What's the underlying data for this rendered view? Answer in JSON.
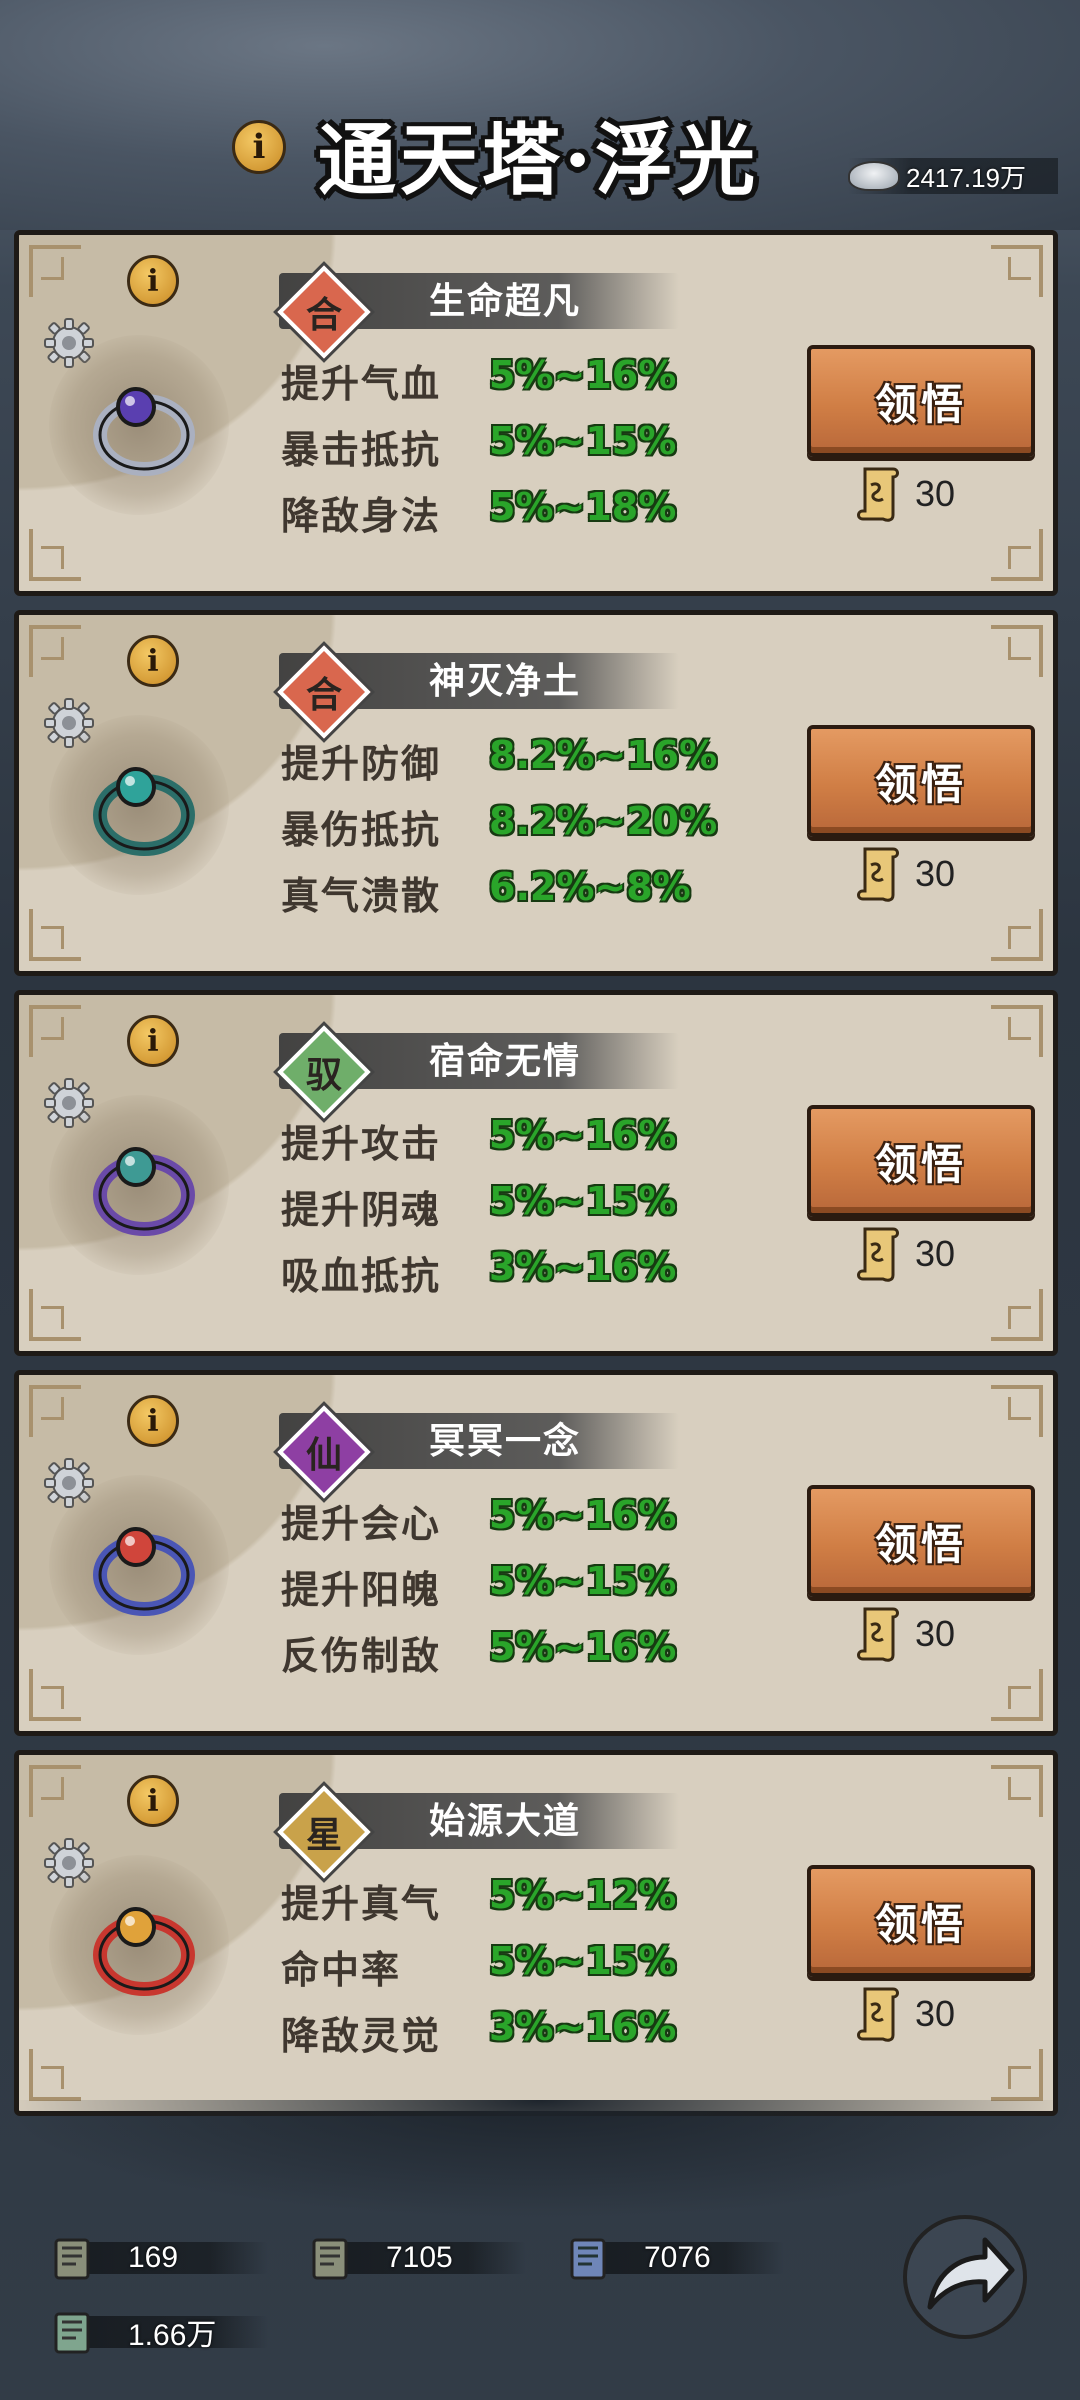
{
  "header": {
    "title": "通天塔·浮光",
    "info_glyph": "i",
    "currency_value": "2417.19万"
  },
  "panels": [
    {
      "badge": "合",
      "badge_color": "#d9674e",
      "name": "生命超凡",
      "item_icon": "ring-purple-gem-icon",
      "stats": [
        {
          "label": "提升气血",
          "value": "5%~16%"
        },
        {
          "label": "暴击抵抗",
          "value": "5%~15%"
        },
        {
          "label": "降敌身法",
          "value": "5%~18%"
        }
      ],
      "button_label": "领悟",
      "cost": "30"
    },
    {
      "badge": "合",
      "badge_color": "#d9674e",
      "name": "神灭净土",
      "item_icon": "necklace-jade-icon",
      "stats": [
        {
          "label": "提升防御",
          "value": "8.2%~16%"
        },
        {
          "label": "暴伤抵抗",
          "value": "8.2%~20%"
        },
        {
          "label": "真气溃散",
          "value": "6.2%~8%"
        }
      ],
      "button_label": "领悟",
      "cost": "30"
    },
    {
      "badge": "驭",
      "badge_color": "#6fae6a",
      "name": "宿命无情",
      "item_icon": "ring-jade-purple-icon",
      "stats": [
        {
          "label": "提升攻击",
          "value": "5%~16%"
        },
        {
          "label": "提升阴魂",
          "value": "5%~15%"
        },
        {
          "label": "吸血抵抗",
          "value": "3%~16%"
        }
      ],
      "button_label": "领悟",
      "cost": "30"
    },
    {
      "badge": "仙",
      "badge_color": "#8e3fa3",
      "name": "冥冥一念",
      "item_icon": "red-pendant-icon",
      "stats": [
        {
          "label": "提升会心",
          "value": "5%~16%"
        },
        {
          "label": "提升阳魄",
          "value": "5%~15%"
        },
        {
          "label": "反伤制敌",
          "value": "5%~16%"
        }
      ],
      "button_label": "领悟",
      "cost": "30"
    },
    {
      "badge": "星",
      "badge_color": "#c9a24a",
      "name": "始源大道",
      "item_icon": "gold-ring-red-gem-icon",
      "stats": [
        {
          "label": "提升真气",
          "value": "5%~12%"
        },
        {
          "label": "命中率",
          "value": "5%~15%"
        },
        {
          "label": "降敌灵觉",
          "value": "3%~16%"
        }
      ],
      "button_label": "领悟",
      "cost": "30"
    }
  ],
  "footer": {
    "resources": [
      {
        "icon": "scroll-book-icon",
        "value": "169"
      },
      {
        "icon": "scroll-book-icon",
        "value": "7105"
      },
      {
        "icon": "scroll-book-blue-icon",
        "value": "7076"
      },
      {
        "icon": "scroll-book-icon",
        "value": "1.66万"
      }
    ],
    "back_icon": "back-arrow-icon"
  }
}
